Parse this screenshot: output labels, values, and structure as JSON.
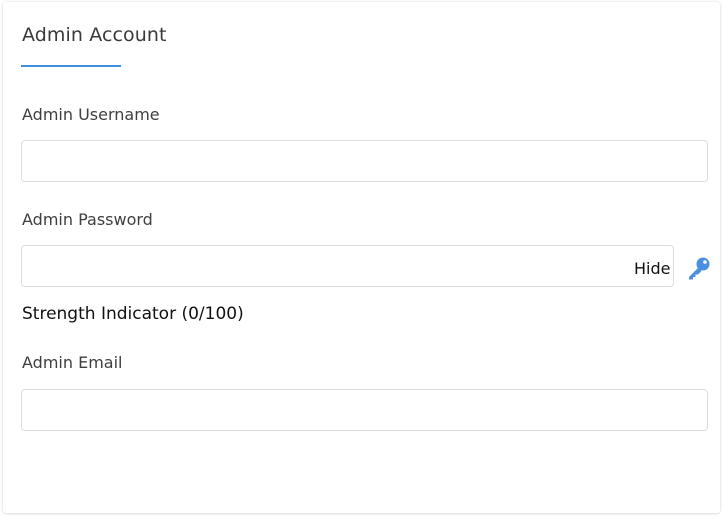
{
  "section": {
    "title": "Admin Account"
  },
  "fields": {
    "username": {
      "label": "Admin Username",
      "value": ""
    },
    "password": {
      "label": "Admin Password",
      "value": "",
      "toggle_label": "Hide",
      "generate_icon": "key-icon",
      "strength_label": "Strength Indicator (0/100)"
    },
    "email": {
      "label": "Admin Email",
      "value": ""
    }
  },
  "colors": {
    "accent": "#3d8fe0",
    "icon": "#4a90e2"
  }
}
